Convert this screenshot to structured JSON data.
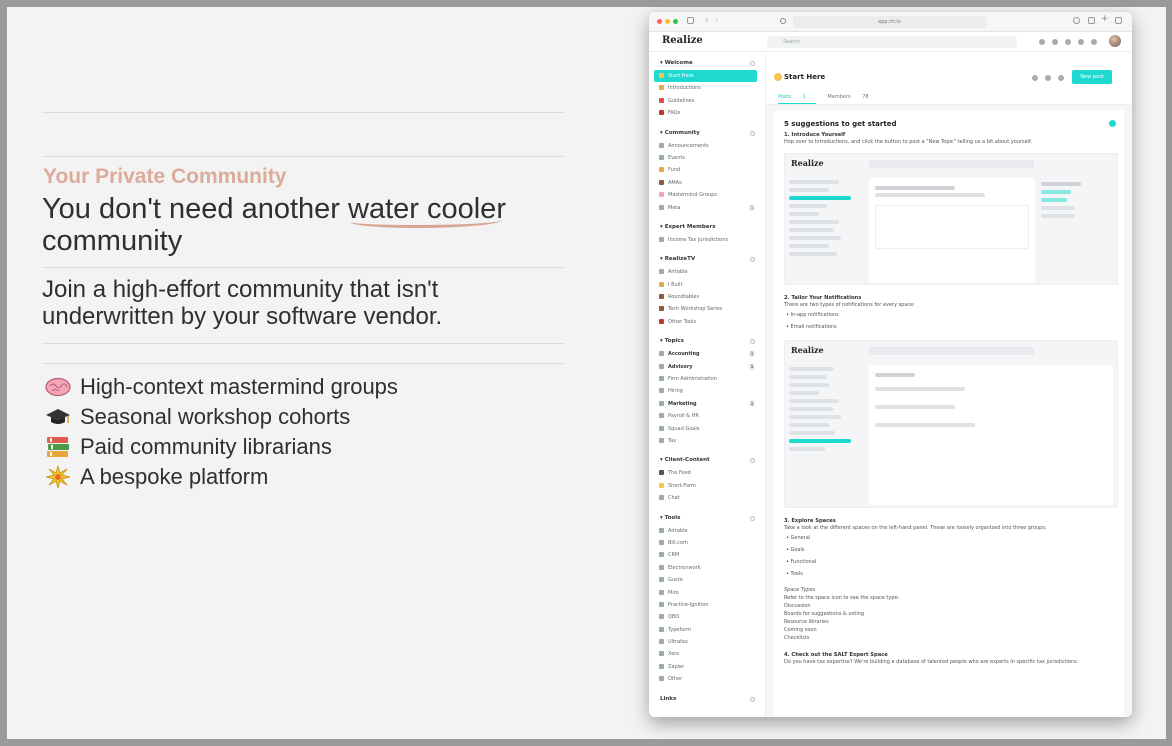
{
  "hero": {
    "eyebrow": "Your Private Community",
    "headline_pre": "You don't need another ",
    "headline_mark": "water cooler",
    "headline_post": " community",
    "subhead": "Join a high-effort community that isn't underwritten by your software vendor.",
    "features": [
      {
        "emoji": "brain-icon",
        "text": "High-context mastermind groups"
      },
      {
        "emoji": "graduation-cap-icon",
        "text": "Seasonal workshop cohorts"
      },
      {
        "emoji": "books-icon",
        "text": "Paid community librarians"
      },
      {
        "emoji": "sparkle-burst-icon",
        "text": "A bespoke platform"
      }
    ]
  },
  "browser": {
    "url": "app.rtr.io"
  },
  "app": {
    "brand": "Realize",
    "search_placeholder": "Search",
    "page_title": "Start Here",
    "new_post": "New post",
    "tabs": {
      "posts": "Posts",
      "posts_count": "1",
      "members": "Members",
      "members_count": "78"
    }
  },
  "sidebar": {
    "welcome": {
      "title": "Welcome",
      "items": [
        "Start Here",
        "Introductions",
        "Guidelines",
        "FAQs"
      ]
    },
    "community": {
      "title": "Community",
      "items": [
        "Announcements",
        "Events",
        "Fund",
        "AMAs",
        "Mastermind Groups",
        "Meta"
      ]
    },
    "expert": {
      "title": "Expert Members",
      "items": [
        "Income Tax Jurisdictions"
      ]
    },
    "realizetv": {
      "title": "RealizeTV",
      "items": [
        "Airtable",
        "I Built",
        "Roundtables",
        "Tech Workshop Series",
        "Other Tools"
      ]
    },
    "topics": {
      "title": "Topics",
      "items": [
        "Accounting",
        "Advisory",
        "Firm Administration",
        "Hiring",
        "Marketing",
        "Payroll & HR",
        "Squad Goals",
        "Tax"
      ]
    },
    "client": {
      "title": "Client-Content",
      "items": [
        "The Feed",
        "Short-Form",
        "Chat"
      ]
    },
    "tools": {
      "title": "Tools",
      "items": [
        "Airtable",
        "Bill.com",
        "CRM",
        "Electronwork",
        "Gusto",
        "Miro",
        "Practice-Ignition",
        "QBO",
        "Typeform",
        "Ultrafax",
        "Xero",
        "Zapier",
        "Other"
      ]
    },
    "links": {
      "title": "Links"
    }
  },
  "card": {
    "title": "5 suggestions to get started",
    "s1_title": "1. Introduce Yourself",
    "s1_text": "Hop over to Introductions, and click the button to post a \"New Topic\" telling us a bit about yourself.",
    "s2_title": "2. Tailor Your Notifications",
    "s2_text": "There are two types of notifications for every space:",
    "s2_items": [
      "In-app notifications",
      "Email notifications"
    ],
    "s3_title": "3. Explore Spaces",
    "s3_text": "Take a look at the different spaces on the left-hand panel. These are loosely organized into three groups:",
    "s3_items": [
      "General",
      "Goals",
      "Functional",
      "Tools"
    ],
    "types_title": "Space Types",
    "types_text": "Refer to the space icon to see the space type:",
    "types_items": [
      "Discussion",
      "Boards for suggestions & voting",
      "Resource libraries",
      "Coming soon",
      "Checklists"
    ],
    "s4_title": "4. Check out the SALT Expert Space",
    "s4_text": "Do you have tax expertise? We're building a database of talented people who are experts in specific tax jurisdictions."
  },
  "colors": {
    "accent": "#1ed9cf",
    "eyebrow": "#dcab99",
    "underline": "#d7a594"
  }
}
